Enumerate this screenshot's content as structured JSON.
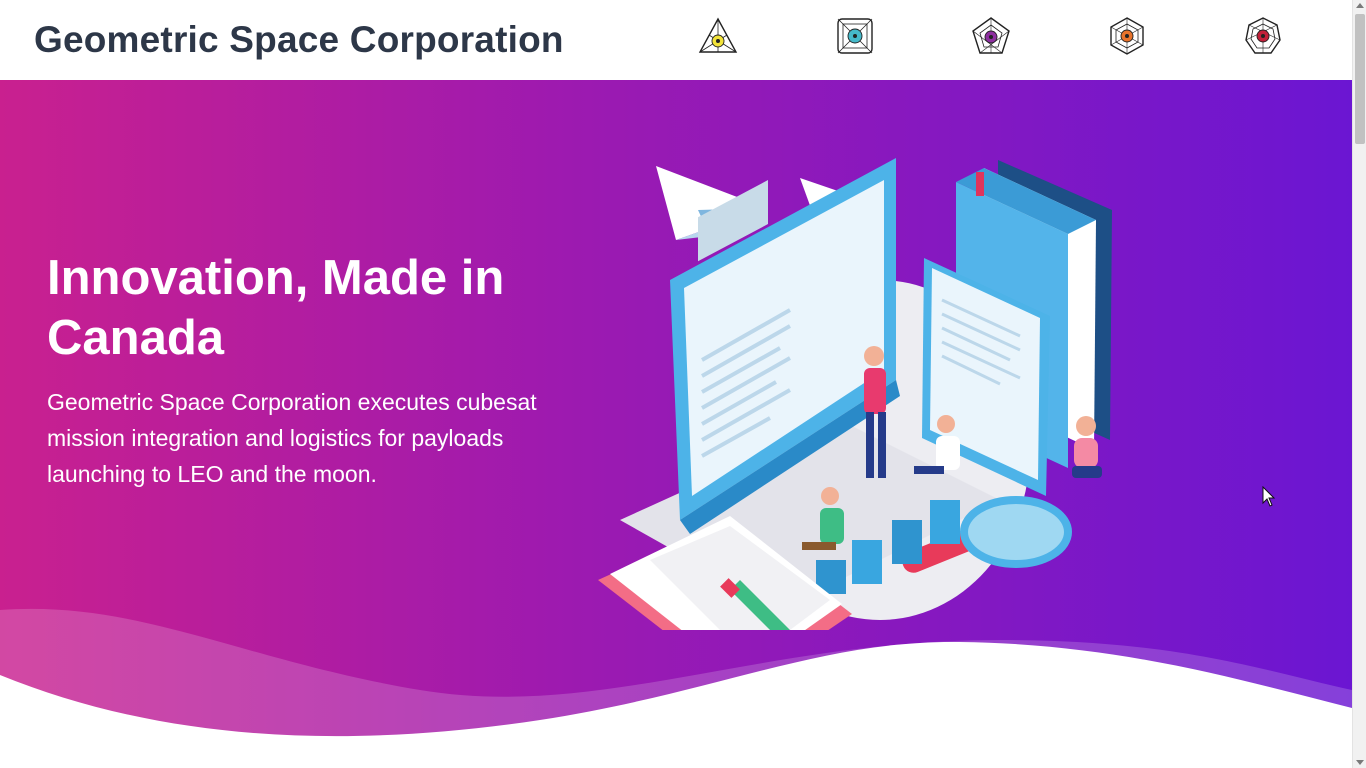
{
  "header": {
    "brand": "Geometric Space Corporation",
    "nav_icons": [
      {
        "name": "triangle-emblem-icon",
        "accent": "#f2e33a"
      },
      {
        "name": "square-emblem-icon",
        "accent": "#45b9c9"
      },
      {
        "name": "pentagon-emblem-icon",
        "accent": "#8e2fa0"
      },
      {
        "name": "hexagon-emblem-icon",
        "accent": "#e8732b"
      },
      {
        "name": "heptagon-emblem-icon",
        "accent": "#c2203a"
      }
    ]
  },
  "hero": {
    "title": "Innovation, Made in Canada",
    "description": "Geometric Space Corporation executes cubesat mission integration and logistics for payloads launching to LEO and the moon.",
    "gradient_start": "#c9208f",
    "gradient_end": "#6b16d2"
  }
}
